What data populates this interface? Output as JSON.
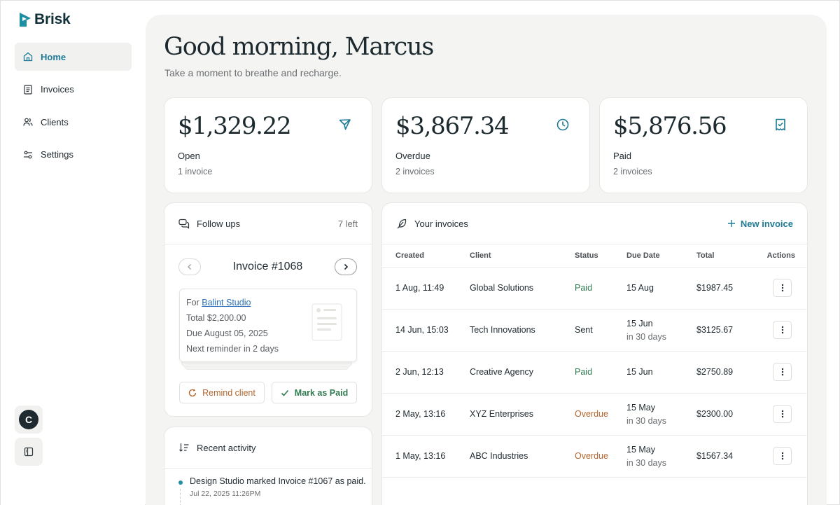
{
  "app": {
    "name": "Brisk"
  },
  "sidebar": {
    "items": [
      {
        "label": "Home",
        "icon": "home-icon",
        "active": true
      },
      {
        "label": "Invoices",
        "icon": "document-icon",
        "active": false
      },
      {
        "label": "Clients",
        "icon": "users-icon",
        "active": false
      },
      {
        "label": "Settings",
        "icon": "sliders-icon",
        "active": false
      }
    ],
    "avatar_initial": "C"
  },
  "header": {
    "greeting": "Good morning, Marcus",
    "subtitle": "Take a moment to breathe and recharge."
  },
  "stats": [
    {
      "amount": "$1,329.22",
      "label": "Open",
      "sub": "1 invoice",
      "icon": "send-icon"
    },
    {
      "amount": "$3,867.34",
      "label": "Overdue",
      "sub": "2 invoices",
      "icon": "clock-icon"
    },
    {
      "amount": "$5,876.56",
      "label": "Paid",
      "sub": "2 invoices",
      "icon": "receipt-check-icon"
    }
  ],
  "followups": {
    "title": "Follow ups",
    "remaining": "7 left",
    "invoice_title": "Invoice #1068",
    "for_prefix": "For",
    "client": "Balint Studio",
    "total": "Total $2,200.00",
    "due": "Due August 05, 2025",
    "reminder": "Next reminder in 2 days",
    "remind_label": "Remind client",
    "mark_paid_label": "Mark as Paid"
  },
  "activity": {
    "title": "Recent activity",
    "items": [
      {
        "text": "Design Studio marked Invoice #1067 as paid.",
        "time": "Jul 22, 2025 11:26PM"
      }
    ]
  },
  "invoices": {
    "title": "Your invoices",
    "new_label": "New invoice",
    "columns": [
      "Created",
      "Client",
      "Status",
      "Due Date",
      "Total",
      "Actions"
    ],
    "rows": [
      {
        "created": "1 Aug, 11:49",
        "client": "Global Solutions",
        "status": "Paid",
        "due": "15 Aug",
        "due_sub": "",
        "total": "$1987.45"
      },
      {
        "created": "14 Jun, 15:03",
        "client": "Tech Innovations",
        "status": "Sent",
        "due": "15 Jun",
        "due_sub": "in 30 days",
        "total": "$3125.67"
      },
      {
        "created": "2 Jun, 12:13",
        "client": "Creative Agency",
        "status": "Paid",
        "due": "15 Jun",
        "due_sub": "",
        "total": "$2750.89"
      },
      {
        "created": "2 May, 13:16",
        "client": "XYZ Enterprises",
        "status": "Overdue",
        "due": "15 May",
        "due_sub": "in 30 days",
        "total": "$2300.00"
      },
      {
        "created": "1 May, 13:16",
        "client": "ABC Industries",
        "status": "Overdue",
        "due": "15 May",
        "due_sub": "in 30 days",
        "total": "$1567.34"
      }
    ]
  },
  "colors": {
    "accent": "#1e7a95",
    "paid": "#2f7a4f",
    "overdue": "#b3662d",
    "panel": "#f4f4f2"
  }
}
